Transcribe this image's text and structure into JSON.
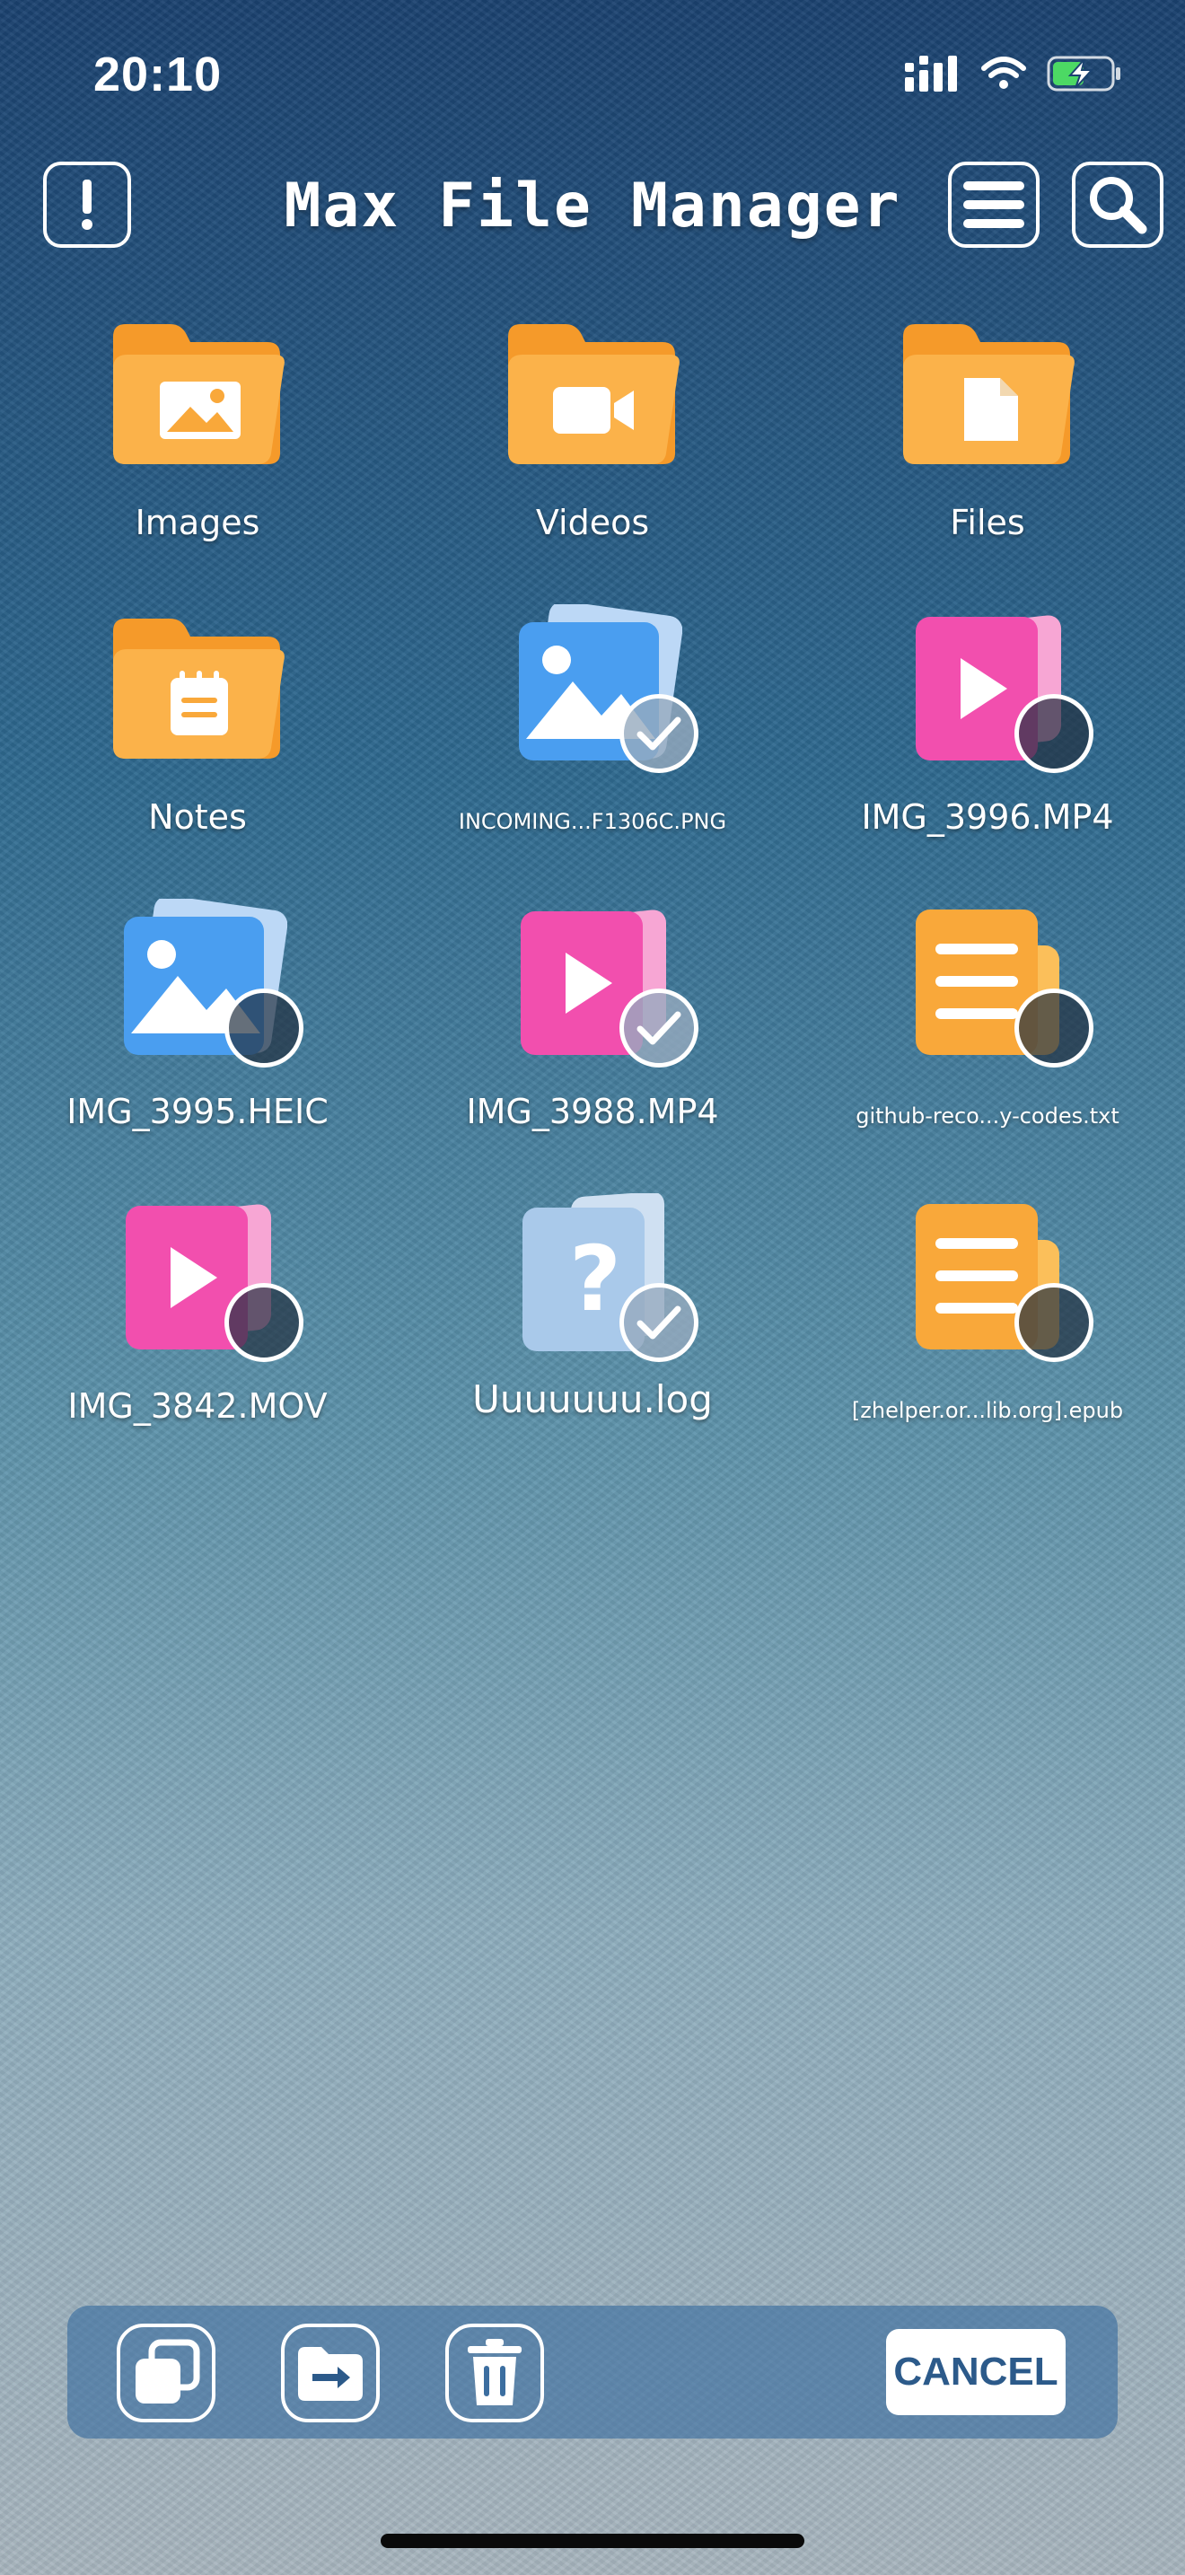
{
  "status_bar": {
    "time": "20:10"
  },
  "header": {
    "title": "Max File Manager",
    "info_icon": "info-exclamation-icon",
    "menu_icon": "menu-icon",
    "search_icon": "search-icon"
  },
  "items": [
    {
      "name": "Images",
      "type": "folder",
      "glyph": "image",
      "label_size": "normal"
    },
    {
      "name": "Videos",
      "type": "folder",
      "glyph": "video",
      "label_size": "normal"
    },
    {
      "name": "Files",
      "type": "folder",
      "glyph": "file",
      "label_size": "normal"
    },
    {
      "name": "Notes",
      "type": "folder",
      "glyph": "notes",
      "label_size": "normal"
    },
    {
      "name": "INCOMING...F1306C.PNG",
      "type": "image",
      "selected": true,
      "label_size": "small"
    },
    {
      "name": "IMG_3996.MP4",
      "type": "video",
      "selected": false,
      "label_size": "normal"
    },
    {
      "name": "IMG_3995.HEIC",
      "type": "image",
      "selected": false,
      "label_size": "normal"
    },
    {
      "name": "IMG_3988.MP4",
      "type": "video",
      "selected": true,
      "label_size": "normal"
    },
    {
      "name": "github-reco...y-codes.txt",
      "type": "text",
      "selected": false,
      "label_size": "small"
    },
    {
      "name": "IMG_3842.MOV",
      "type": "video",
      "selected": false,
      "label_size": "normal"
    },
    {
      "name": "Uuuuuuu.log",
      "type": "unknown",
      "selected": true,
      "label_size": "large"
    },
    {
      "name": "[zhelper.or...lib.org].epub",
      "type": "text",
      "selected": false,
      "label_size": "small"
    }
  ],
  "toolbar": {
    "copy_icon": "copy-icon",
    "move_icon": "move-to-folder-icon",
    "delete_icon": "trash-icon",
    "cancel_label": "CANCEL"
  },
  "colors": {
    "folder_orange": "#f9a83a",
    "video_pink": "#f24fae",
    "image_blue": "#4a9ef0",
    "unknown_blue": "#a9c9ea",
    "toolbar_bg": "#3c6ea0",
    "cancel_text": "#2c5a8a"
  }
}
